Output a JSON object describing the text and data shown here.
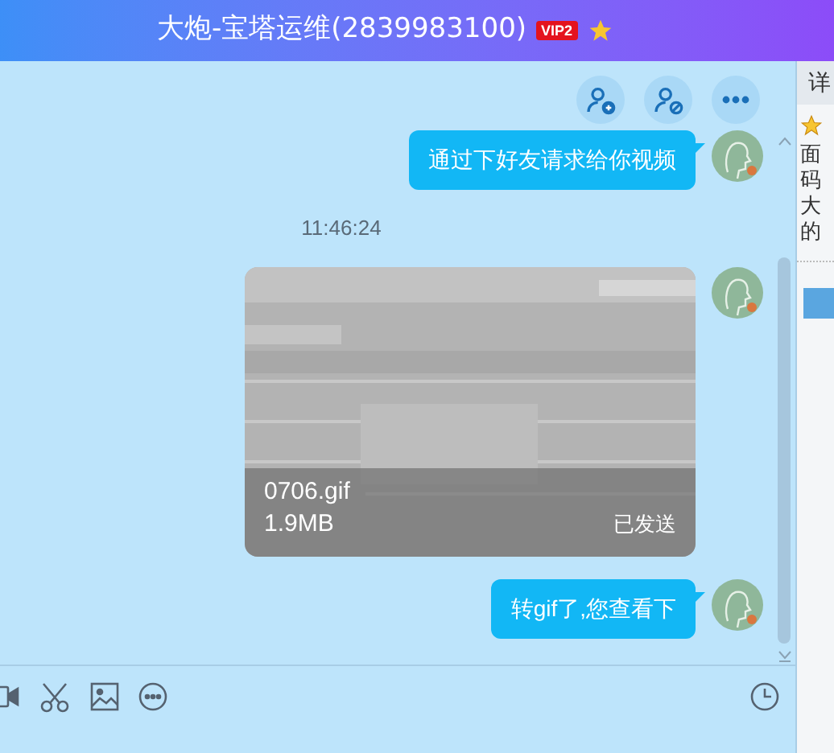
{
  "window": {
    "title": "大炮-宝塔运维(2839983100)",
    "vip_badge": "VIP2"
  },
  "messages": [
    {
      "kind": "text",
      "text": "通过下好友请求给你视频"
    },
    {
      "kind": "time",
      "text": "11:46:24"
    },
    {
      "kind": "file",
      "name": "0706.gif",
      "size": "1.9MB",
      "status": "已发送"
    },
    {
      "kind": "text",
      "text": "转gif了,您查看下"
    }
  ],
  "side_panel": {
    "header": "详",
    "lines": [
      "面",
      "码",
      "大",
      "的"
    ]
  }
}
